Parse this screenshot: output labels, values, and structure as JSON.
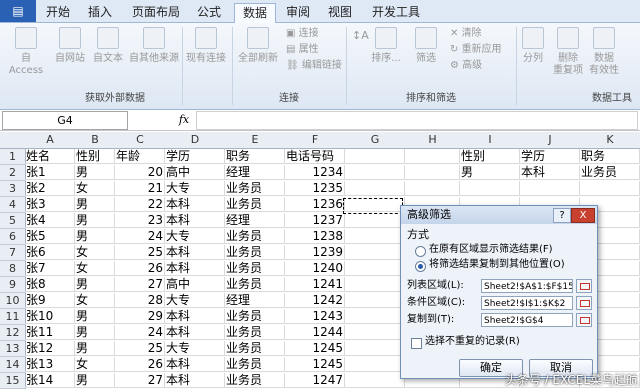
{
  "tabs": [
    "开始",
    "插入",
    "页面布局",
    "公式",
    "数据",
    "审阅",
    "视图",
    "开发工具"
  ],
  "active_tab": "数据",
  "ribbon": {
    "access": "自 Access",
    "web": "自网站",
    "text": "自文本",
    "other_sources": "自其他来源",
    "existing": "现有连接",
    "refresh_all": "全部刷新",
    "connections": "连接",
    "properties": "属性",
    "edit_links": "编辑链接",
    "sort": "排序...",
    "filter": "筛选",
    "clear": "清除",
    "reapply": "重新应用",
    "advanced": "高级",
    "split": "分列",
    "remove_dup_1": "删除",
    "remove_dup_2": "重复项",
    "validate_1": "数据",
    "validate_2": "有效性",
    "group_external": "获取外部数据",
    "group_connect": "连接",
    "group_sort": "排序和筛选",
    "group_tools": "数据工具"
  },
  "formula_bar": {
    "name_box": "G4",
    "fx": "fx",
    "content": ""
  },
  "columns": [
    "A",
    "B",
    "C",
    "D",
    "E",
    "F",
    "G",
    "H",
    "I",
    "J",
    "K"
  ],
  "rows": [
    {
      "n": "1",
      "A": "姓名",
      "B": "性别",
      "C": "年龄",
      "D": "学历",
      "E": "职务",
      "F": "电话号码",
      "I": "性别",
      "J": "学历",
      "K": "职务"
    },
    {
      "n": "2",
      "A": "张1",
      "B": "男",
      "C": "20",
      "D": "高中",
      "E": "经理",
      "F": "1234",
      "I": "男",
      "J": "本科",
      "K": "业务员"
    },
    {
      "n": "3",
      "A": "张2",
      "B": "女",
      "C": "21",
      "D": "大专",
      "E": "业务员",
      "F": "1235"
    },
    {
      "n": "4",
      "A": "张3",
      "B": "男",
      "C": "22",
      "D": "本科",
      "E": "业务员",
      "F": "1236"
    },
    {
      "n": "5",
      "A": "张4",
      "B": "男",
      "C": "23",
      "D": "本科",
      "E": "经理",
      "F": "1237"
    },
    {
      "n": "6",
      "A": "张5",
      "B": "男",
      "C": "24",
      "D": "大专",
      "E": "业务员",
      "F": "1238"
    },
    {
      "n": "7",
      "A": "张6",
      "B": "女",
      "C": "25",
      "D": "本科",
      "E": "业务员",
      "F": "1239"
    },
    {
      "n": "8",
      "A": "张7",
      "B": "女",
      "C": "26",
      "D": "本科",
      "E": "业务员",
      "F": "1240"
    },
    {
      "n": "9",
      "A": "张8",
      "B": "男",
      "C": "27",
      "D": "高中",
      "E": "业务员",
      "F": "1241"
    },
    {
      "n": "10",
      "A": "张9",
      "B": "女",
      "C": "28",
      "D": "大专",
      "E": "经理",
      "F": "1242"
    },
    {
      "n": "11",
      "A": "张10",
      "B": "男",
      "C": "29",
      "D": "本科",
      "E": "业务员",
      "F": "1243"
    },
    {
      "n": "12",
      "A": "张11",
      "B": "男",
      "C": "24",
      "D": "本科",
      "E": "业务员",
      "F": "1244"
    },
    {
      "n": "13",
      "A": "张12",
      "B": "男",
      "C": "25",
      "D": "大专",
      "E": "业务员",
      "F": "1245"
    },
    {
      "n": "14",
      "A": "张13",
      "B": "女",
      "C": "26",
      "D": "本科",
      "E": "业务员",
      "F": "1245"
    },
    {
      "n": "15",
      "A": "张14",
      "B": "男",
      "C": "27",
      "D": "本科",
      "E": "业务员",
      "F": "1247"
    }
  ],
  "dialog": {
    "title": "高级筛选",
    "help": "?",
    "close": "X",
    "mode_label": "方式",
    "option1": "在原有区域显示筛选结果(F)",
    "option2": "将筛选结果复制到其他位置(O)",
    "list_label": "列表区域(L):",
    "list_value": "Sheet2!$A$1:$F$15",
    "criteria_label": "条件区域(C):",
    "criteria_value": "Sheet2!$I$1:$K$2",
    "copyto_label": "复制到(T):",
    "copyto_value": "Sheet2!$G$4",
    "unique_label": "选择不重复的记录(R)",
    "ok": "确定",
    "cancel": "取消"
  },
  "watermark": "头条号 / EXCEL菜鸟起航"
}
